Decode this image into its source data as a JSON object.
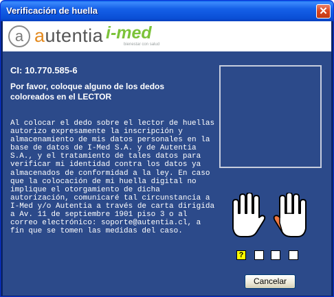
{
  "window": {
    "title": "Verificación de huella",
    "close_icon": "close-icon"
  },
  "header": {
    "autentia_text": "utentia",
    "imed_text": "i-med",
    "imed_tagline": "bienestar con salud"
  },
  "ci": "CI: 10.770.585-6",
  "instruction": "Por favor, coloque alguno de los dedos coloreados en el LECTOR",
  "consent": "Al colocar el dedo sobre el lector de huellas autorizo expresamente la inscripción y almacenamiento de mis datos personales en la base de datos de I-Med S.A. y de Autentia S.A., y el tratamiento de tales datos para verificar mi identidad contra los datos ya almacenados de conformidad a la ley. En caso que la colocación de mi huella digital no implique el otorgamiento de dicha autorización, comunicaré tal circunstancia a I-Med y/o Autentia a través de carta dirigida a Av. 11 de septiembre 1901 piso 3 o al correo electrónico: soporte@autentia.cl, a fin que se tomen las medidas del caso.",
  "fingers": {
    "active_marker": "?",
    "highlight_color": "#f07840",
    "active_box_color": "#ffff00"
  },
  "cancel_button": "Cancelar"
}
